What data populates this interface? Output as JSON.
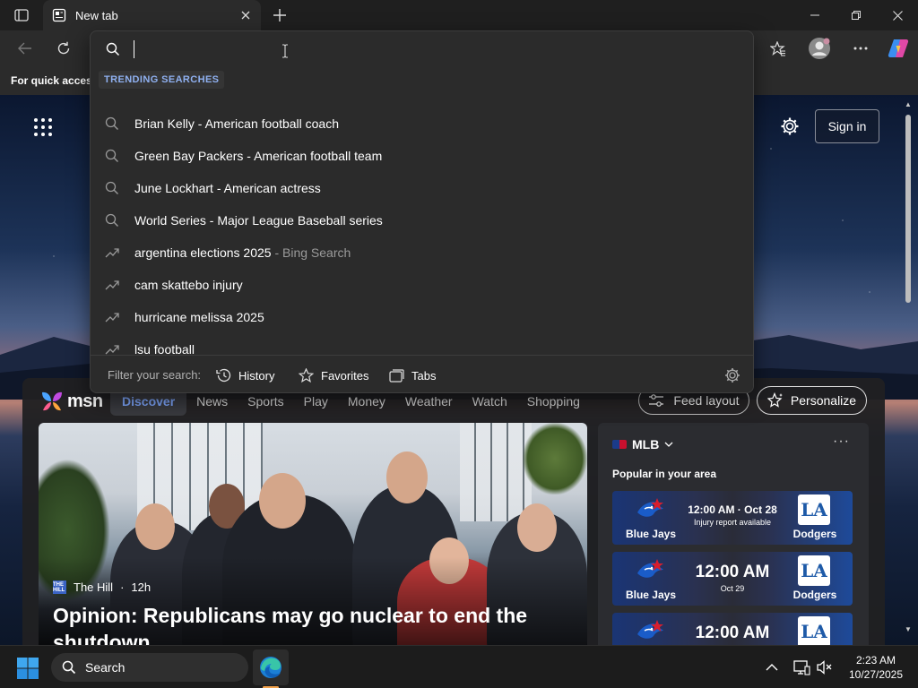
{
  "tab": {
    "title": "New tab"
  },
  "favorites_bar": {
    "text": "For quick access"
  },
  "address": {
    "value": "",
    "placeholder": ""
  },
  "dropdown": {
    "header": "TRENDING SEARCHES",
    "suggestions": [
      {
        "icon": "search-icon",
        "term": "Brian Kelly",
        "sep": " - ",
        "desc": "American football coach",
        "muted": ""
      },
      {
        "icon": "search-icon",
        "term": "Green Bay Packers",
        "sep": " - ",
        "desc": "American football team",
        "muted": ""
      },
      {
        "icon": "search-icon",
        "term": "June Lockhart",
        "sep": " - ",
        "desc": "American actress",
        "muted": ""
      },
      {
        "icon": "search-icon",
        "term": "World Series",
        "sep": " - ",
        "desc": "Major League Baseball series",
        "muted": ""
      },
      {
        "icon": "trending-icon",
        "term": "argentina elections 2025",
        "sep": " - ",
        "desc": "",
        "muted": "Bing Search"
      },
      {
        "icon": "trending-icon",
        "term": "cam skattebo injury",
        "sep": "",
        "desc": "",
        "muted": ""
      },
      {
        "icon": "trending-icon",
        "term": "hurricane melissa 2025",
        "sep": "",
        "desc": "",
        "muted": ""
      },
      {
        "icon": "trending-icon",
        "term": "lsu football",
        "sep": "",
        "desc": "",
        "muted": ""
      }
    ],
    "filter": {
      "label": "Filter your search:",
      "history": "History",
      "favorites": "Favorites",
      "tabs": "Tabs"
    }
  },
  "page": {
    "sign_in": "Sign in"
  },
  "msn": {
    "logo": "msn",
    "nav": [
      "Discover",
      "News",
      "Sports",
      "Play",
      "Money",
      "Weather",
      "Watch",
      "Shopping"
    ],
    "active_nav": "Discover",
    "feed_layout": "Feed layout",
    "personalize": "Personalize",
    "hero": {
      "source": "The Hill",
      "source_logo": "THE HILL",
      "age": "12h",
      "title": "Opinion: Republicans may go nuclear to end the shutdown"
    },
    "sports": {
      "league": "MLB",
      "subtitle": "Popular in your area",
      "more": "···",
      "games": [
        {
          "home": "Blue Jays",
          "away": "Dodgers",
          "time": "12:00 AM · Oct 28",
          "note": "Injury report available",
          "style": "small"
        },
        {
          "home": "Blue Jays",
          "away": "Dodgers",
          "time": "12:00 AM",
          "note": "Oct 29",
          "style": "big"
        },
        {
          "home": "Blue Jays",
          "away": "Dodgers",
          "time": "12:00 AM",
          "note": "",
          "style": "big"
        }
      ],
      "away_logo_text": "LA"
    }
  },
  "taskbar": {
    "search": "Search",
    "time": "2:23 AM",
    "date": "10/27/2025"
  },
  "colors": {
    "accent": "#7fa8ff",
    "trend_header": "#8fb0f0",
    "edge_indicator": "#f3a24b"
  }
}
